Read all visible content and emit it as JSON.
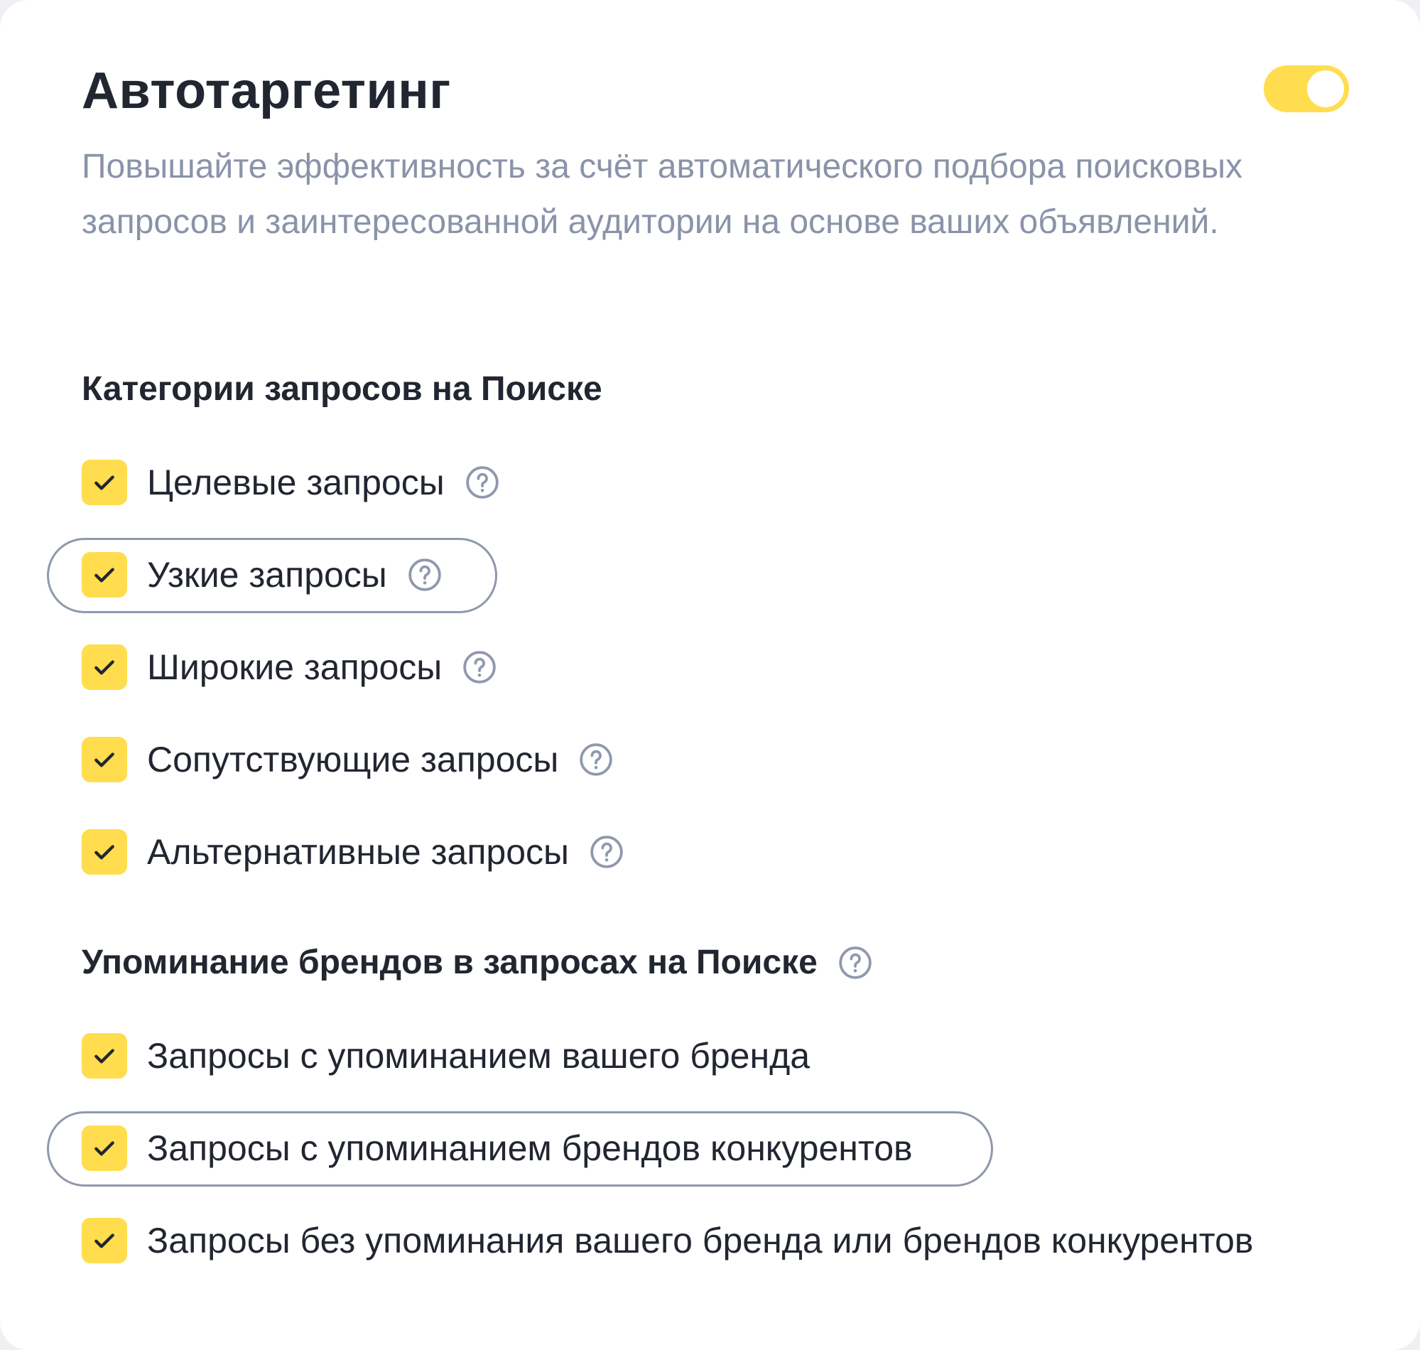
{
  "theme": {
    "accent": "#ffdd4e",
    "text": "#222631",
    "muted": "#8a93a8",
    "outline": "#8f98ad"
  },
  "header": {
    "title": "Автотаргетинг",
    "toggle_on": true,
    "toggle_icon": "toggle-switch"
  },
  "description": "Повышайте эффективность за счёт автоматического подбора поисковых запросов и заинтересованной аудитории на основе ваших объявлений.",
  "search_categories": {
    "title": "Категории запросов на Поиске",
    "items": [
      {
        "label": "Целевые запросы",
        "checked": true,
        "help_icon": "question-circle-icon"
      },
      {
        "label": "Узкие запросы",
        "checked": true,
        "help_icon": "question-circle-icon",
        "highlighted": true
      },
      {
        "label": "Широкие запросы",
        "checked": true,
        "help_icon": "question-circle-icon"
      },
      {
        "label": "Сопутствующие запросы",
        "checked": true,
        "help_icon": "question-circle-icon"
      },
      {
        "label": "Альтернативные запросы",
        "checked": true,
        "help_icon": "question-circle-icon"
      }
    ]
  },
  "brand_mentions": {
    "title": "Упоминание брендов в запросах на Поиске",
    "help_icon": "question-circle-icon",
    "items": [
      {
        "label": "Запросы с упоминанием вашего бренда",
        "checked": true
      },
      {
        "label": "Запросы с упоминанием брендов конкурентов",
        "checked": true,
        "highlighted": true
      },
      {
        "label": "Запросы без упоминания вашего бренда или брендов конкурентов",
        "checked": true
      }
    ]
  }
}
